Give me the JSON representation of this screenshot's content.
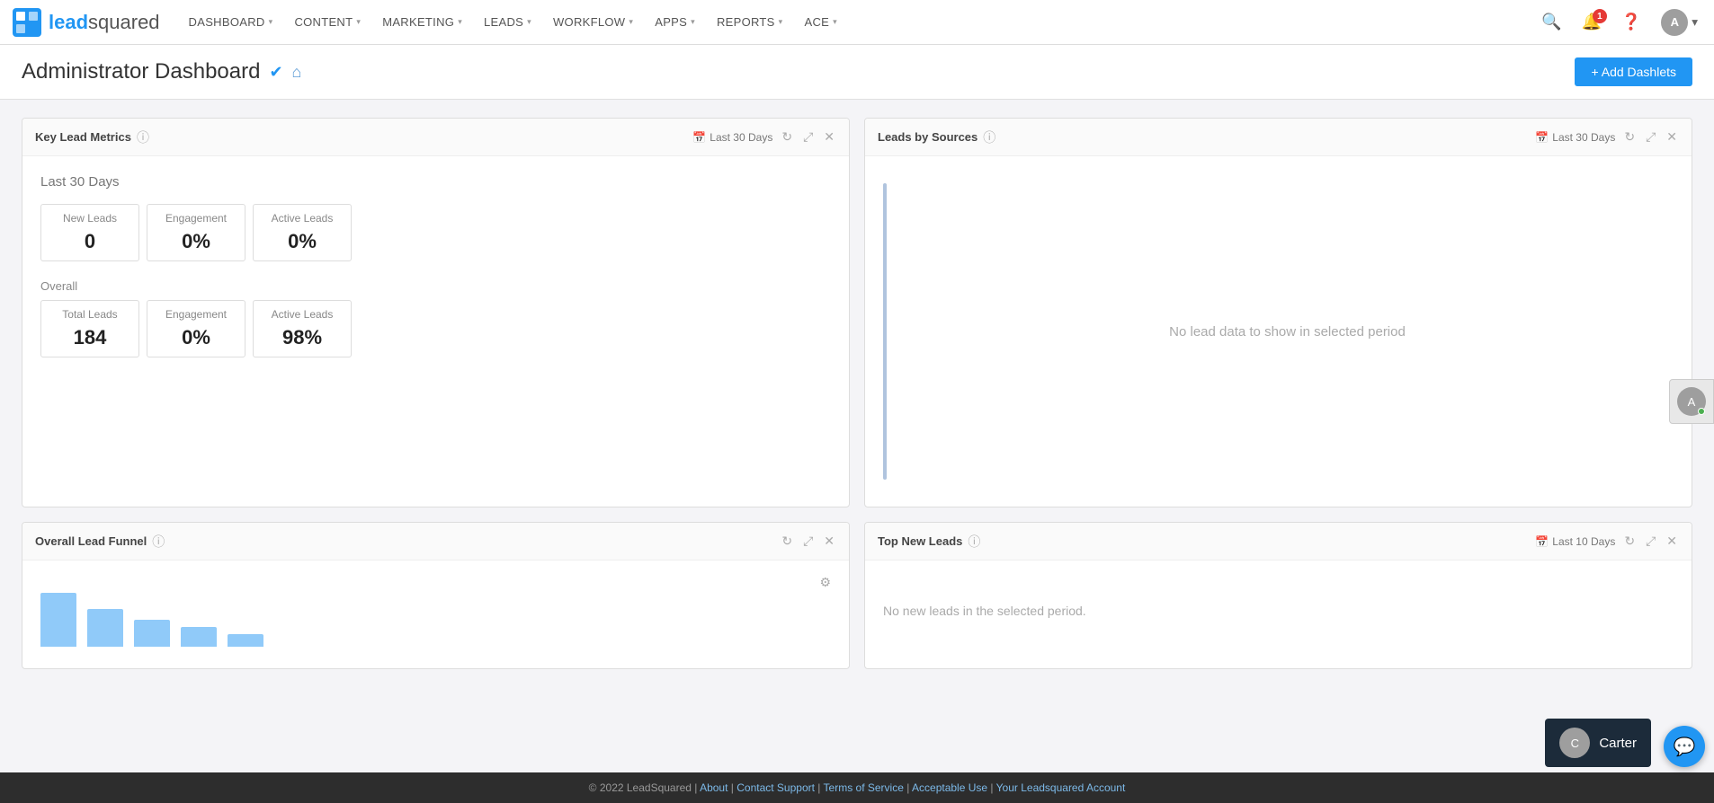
{
  "logo": {
    "text_lead": "lead",
    "text_squared": "squared"
  },
  "nav": {
    "items": [
      {
        "label": "DASHBOARD",
        "id": "dashboard"
      },
      {
        "label": "CONTENT",
        "id": "content"
      },
      {
        "label": "MARKETING",
        "id": "marketing"
      },
      {
        "label": "LEADS",
        "id": "leads"
      },
      {
        "label": "WORKFLOW",
        "id": "workflow"
      },
      {
        "label": "APPS",
        "id": "apps"
      },
      {
        "label": "REPORTS",
        "id": "reports"
      },
      {
        "label": "ACE",
        "id": "ace"
      }
    ],
    "notification_count": "1"
  },
  "page_header": {
    "title": "Administrator Dashboard",
    "add_dashlets_label": "+ Add Dashlets"
  },
  "dashlets": {
    "key_lead_metrics": {
      "title": "Key Lead Metrics",
      "date_filter": "Last 30 Days",
      "section_label": "Last 30 Days",
      "last30": {
        "label": "Last 30 Days",
        "cols": [
          "New Leads",
          "Engagement",
          "Active Leads"
        ],
        "values": [
          "0",
          "0%",
          "0%"
        ]
      },
      "overall": {
        "label": "Overall",
        "cols": [
          "Total Leads",
          "Engagement",
          "Active Leads"
        ],
        "values": [
          "184",
          "0%",
          "98%"
        ]
      }
    },
    "leads_by_sources": {
      "title": "Leads by Sources",
      "date_filter": "Last 30 Days",
      "empty_message": "No lead data to show in selected period"
    },
    "overall_lead_funnel": {
      "title": "Overall Lead Funnel",
      "bars": [
        50,
        35,
        25,
        18,
        12
      ]
    },
    "top_new_leads": {
      "title": "Top New Leads",
      "date_filter": "Last 10 Days",
      "empty_message": "No new leads in the selected period."
    }
  },
  "footer": {
    "copyright": "© 2022 LeadSquared",
    "links": [
      "About",
      "Contact Support",
      "Terms of Service",
      "Acceptable Use",
      "Your Leadsquared Account"
    ]
  },
  "carter": {
    "name": "Carter"
  }
}
